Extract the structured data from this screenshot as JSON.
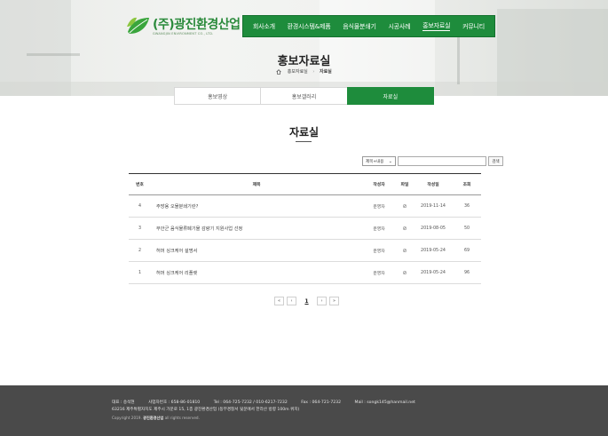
{
  "logo": {
    "name": "(주)광진환경산업",
    "sub": "GWANGJIN ENVIRONMENT CO., LTD."
  },
  "nav": [
    {
      "label": "회사소개",
      "active": false
    },
    {
      "label": "환경시스템&제품",
      "active": false
    },
    {
      "label": "음식물분쇄기",
      "active": false
    },
    {
      "label": "시공사례",
      "active": false
    },
    {
      "label": "홍보자료실",
      "active": true
    },
    {
      "label": "커뮤니티",
      "active": false
    }
  ],
  "hero": {
    "title": "홍보자료실",
    "breadcrumb": {
      "parent": "홍보자료실",
      "current": "자료실"
    }
  },
  "tabs": [
    {
      "label": "홍보영상",
      "active": false
    },
    {
      "label": "홍보갤러리",
      "active": false
    },
    {
      "label": "자료실",
      "active": true
    }
  ],
  "section": {
    "title": "자료실"
  },
  "search": {
    "select_value": "제목+내용",
    "input_value": "",
    "button_label": "검색"
  },
  "board": {
    "headers": {
      "no": "번호",
      "title": "제목",
      "writer": "작성자",
      "file": "파일",
      "date": "작성일",
      "views": "조회"
    },
    "rows": [
      {
        "no": "4",
        "title": "주방용 오물분쇄기란?",
        "writer": "운영자",
        "file": "⊘",
        "date": "2019-11-14",
        "views": "36"
      },
      {
        "no": "3",
        "title": "무안군 음식물류폐기물 감량기 지원사업 선정",
        "writer": "운영자",
        "file": "⊘",
        "date": "2019-08-05",
        "views": "50"
      },
      {
        "no": "2",
        "title": "허머 싱크케어 설명서",
        "writer": "운영자",
        "file": "⊘",
        "date": "2019-05-24",
        "views": "69"
      },
      {
        "no": "1",
        "title": "허머 싱크케어 리플렛",
        "writer": "운영자",
        "file": "⊘",
        "date": "2019-05-24",
        "views": "96"
      }
    ]
  },
  "paging": {
    "first": "«",
    "prev": "‹",
    "current": "1",
    "next": "›",
    "last": "»"
  },
  "footer": {
    "ceo": "대표 : 송석현",
    "bizno": "사업자번호 : 658-86-01810",
    "tel": "Tel : 064-725-7232 / 010-6217-7232",
    "fax": "Fax : 064-721-7232",
    "mail": "Mail : songk145@hanmail.net",
    "address": "63216 제주특별자치도 제주시 가문로 15, 1층 광진환경산업 (동부경찰서 뒷문에서 한라산 방향 100m 위치)",
    "copyright_prefix": "Copyright 2019.",
    "copyright_company": "광진환경산업",
    "copyright_suffix": "all rights reserved."
  }
}
